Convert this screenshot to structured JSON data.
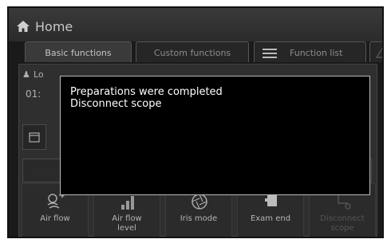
{
  "header": {
    "title": "Home",
    "icon": "home-icon"
  },
  "tabs": [
    {
      "label": "Basic functions",
      "active": true
    },
    {
      "label": "Custom functions",
      "active": false
    },
    {
      "label": "Function list",
      "active": false,
      "icon": "list-icon"
    },
    {
      "label": "",
      "active": false,
      "icon": "extra-tab-icon"
    }
  ],
  "background": {
    "partial_label_1": "Lo",
    "partial_label_2": "01:",
    "partial_right": "d"
  },
  "bottom_buttons": [
    {
      "label": "Air flow",
      "icon": "air-flow-icon",
      "enabled": true
    },
    {
      "label": "Air flow level",
      "icon": "air-flow-level-icon",
      "enabled": true
    },
    {
      "label": "Iris mode",
      "icon": "iris-mode-icon",
      "enabled": true
    },
    {
      "label": "Exam end",
      "icon": "exam-end-icon",
      "enabled": true
    },
    {
      "label": "Disconnect scope",
      "icon": "disconnect-scope-icon",
      "enabled": false
    }
  ],
  "dialog": {
    "line1": "Preparations were completed",
    "line2": "Disconnect scope"
  },
  "colors": {
    "background": "#1a1a1a",
    "dialog_bg": "#000000",
    "dialog_border": "#b9b9b9",
    "text": "#ffffff"
  }
}
